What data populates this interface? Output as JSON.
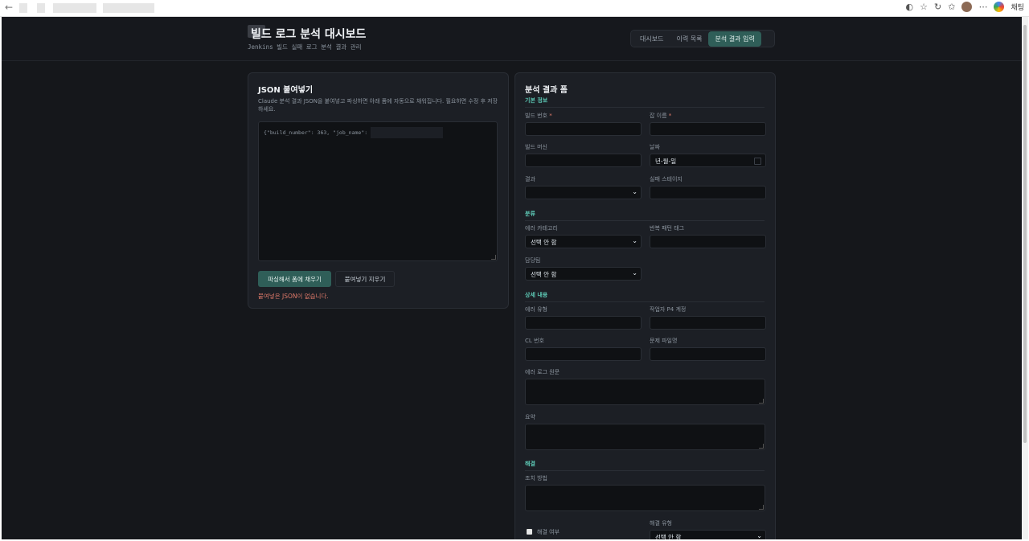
{
  "browser": {
    "chat_label": "채팅"
  },
  "header": {
    "title": "빌드 로그 분석 대시보드",
    "subtitle": "Jenkins 빌드 실패 로그 분석 결과 관리",
    "nav": [
      "대시보드",
      "이력 목록",
      "분석 결과 입력"
    ],
    "active_tab": 2
  },
  "paste_card": {
    "title": "JSON 붙여넣기",
    "description": "Claude 분석 결과 JSON을 붙여넣고 파싱하면 아래 폼에 자동으로 채워집니다. 필요하면 수정 후 저장하세요.",
    "json_value": "{\"build_number\": 363, \"job_name\":",
    "parse_button": "파싱해서 폼에 채우기",
    "clear_button": "붙여넣기 지우기",
    "error": "붙여넣은 JSON이 없습니다."
  },
  "form": {
    "title": "분석 결과 폼",
    "sections": {
      "basic": "기본 정보",
      "category": "분류",
      "detail": "상세 내용",
      "resolution": "해결"
    },
    "labels": {
      "build_number": "빌드 번호",
      "job_name": "잡 이름",
      "build_machine": "빌드 머신",
      "date": "날짜",
      "result": "결과",
      "failed_stage": "실패 스테이지",
      "error_category": "에러 카테고리",
      "repeat_tag": "반복 패턴 태그",
      "owner": "담당팀",
      "error_type": "에러 유형",
      "p4_account": "작업자 P4 계정",
      "cl_number": "CL 번호",
      "problem_file": "문제 파일명",
      "error_log": "에러 로그 원문",
      "summary": "요약",
      "action": "조치 방법",
      "resolved": "해결 여부",
      "resolution_type": "해결 유형"
    },
    "required_mark": "*",
    "values": {
      "date_placeholder": "년-월-일",
      "error_category": "선택 안 함",
      "owner": "선택 안 함",
      "resolution_type": "선택 안 함",
      "result": ""
    },
    "resolved_checked": false
  }
}
